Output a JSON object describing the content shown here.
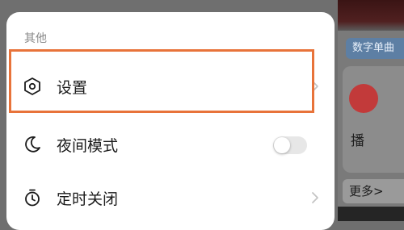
{
  "background": {
    "pill_text": "数字单曲",
    "card_text": "播",
    "more_text": "更多>"
  },
  "sheet": {
    "section_title": "其他",
    "items": [
      {
        "label": "设置",
        "icon": "hexagon-settings-icon",
        "control": "chevron"
      },
      {
        "label": "夜间模式",
        "icon": "moon-icon",
        "control": "toggle",
        "toggle_on": false
      },
      {
        "label": "定时关闭",
        "icon": "timer-icon",
        "control": "chevron"
      }
    ]
  },
  "colors": {
    "highlight": "#e8733a",
    "sheet_bg": "#ffffff",
    "overlay": "#6f6f6f"
  }
}
